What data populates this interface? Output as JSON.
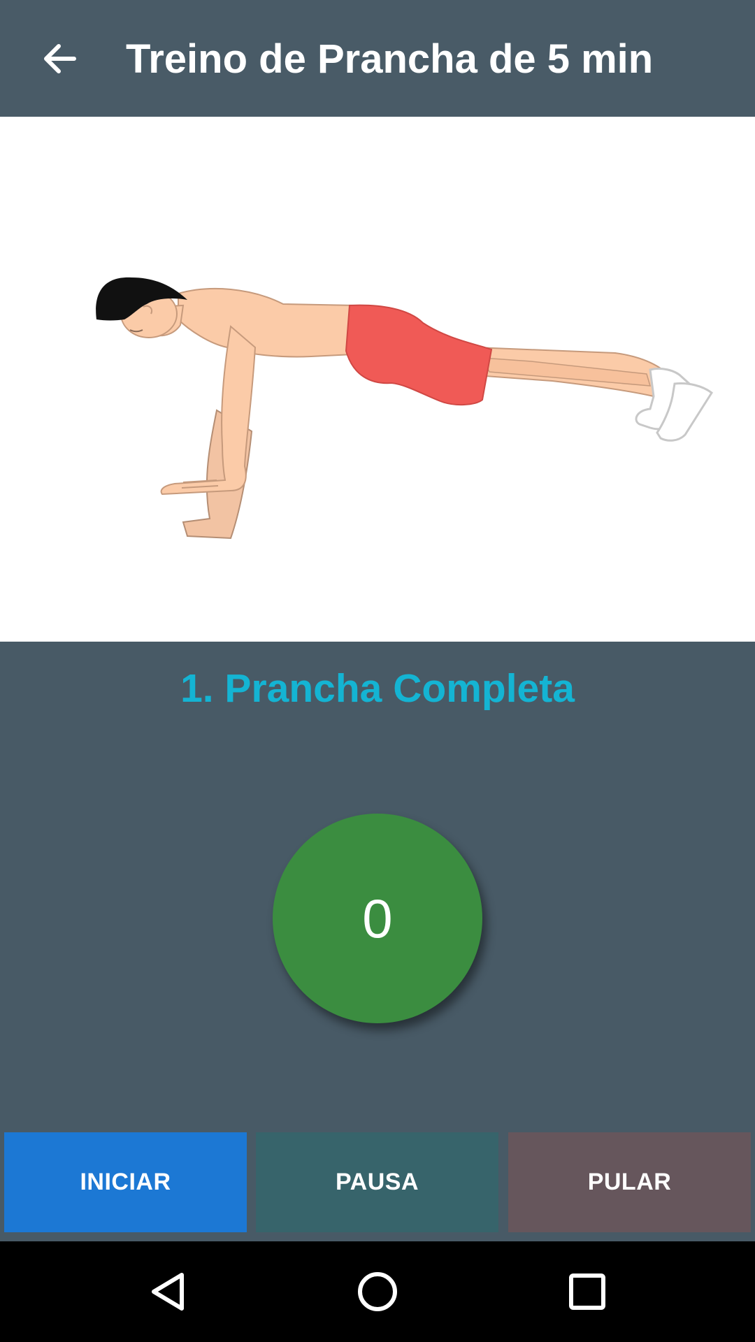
{
  "app_bar": {
    "title": "Treino de Prancha de 5 min",
    "back_icon": "arrow-back-icon"
  },
  "exercise": {
    "illustration": "plank-exercise-illustration",
    "name": "1. Prancha Completa"
  },
  "timer": {
    "value": "0",
    "color": "#3b8d40"
  },
  "controls": {
    "start_label": "INICIAR",
    "pause_label": "PAUSA",
    "skip_label": "PULAR",
    "start_color": "#1c78d4",
    "pause_color": "#37646b",
    "skip_color": "#66565c"
  },
  "nav_bar": {
    "icons": [
      "back-triangle-icon",
      "home-circle-icon",
      "recents-square-icon"
    ]
  },
  "colors": {
    "app_bar": "#495b67",
    "background": "#485a66",
    "accent_title": "#14b4d3"
  }
}
